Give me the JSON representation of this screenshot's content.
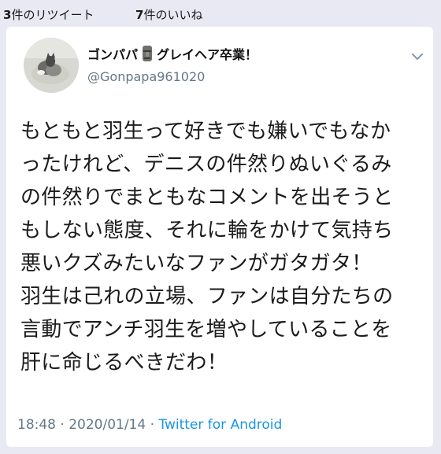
{
  "engagement": {
    "retweets_count": "3",
    "retweets_label": "件のリツイート",
    "likes_count": "7",
    "likes_label": "件のいいね"
  },
  "tweet": {
    "author": {
      "display_name_part1": "ゴンパパ",
      "display_name_part2": "グレイヘア卒業！",
      "handle": "@Gonpapa961020",
      "avatar_icon": "cat-avatar-icon",
      "name_emoji_icon": "moai-icon"
    },
    "text_lines": [
      "もともと羽生って好きでも嫌いでもなか",
      "ったけれど、デニスの件然りぬいぐるみ",
      "の件然りでまともなコメントを出そうと",
      "もしない態度、それに輪をかけて気持ち",
      "悪いクズみたいなファンがガタガタ！",
      "羽生は己れの立場、ファンは自分たちの",
      "言動でアンチ羽生を増やしていることを",
      "肝に命じるべきだわ！"
    ],
    "timestamp": "18:48 · 2020/01/14 · ",
    "source": "Twitter for Android"
  },
  "colors": {
    "background": "#e9e9f4",
    "card": "#ffffff",
    "secondary_text": "#657786",
    "link": "#1b95e0"
  }
}
